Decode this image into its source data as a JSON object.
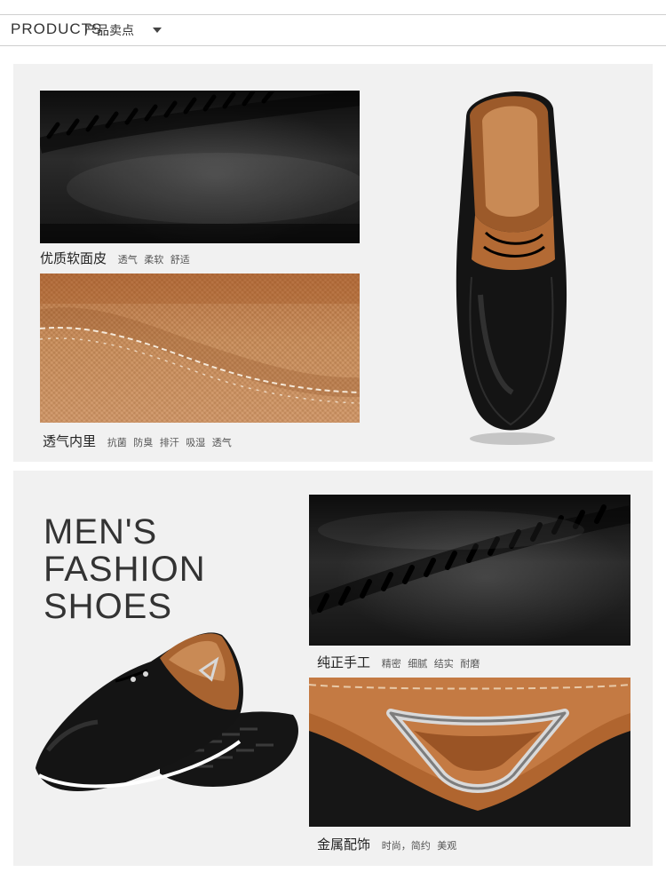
{
  "header": {
    "title_en": "PRODUCTS",
    "title_cn": "产品卖点"
  },
  "features": [
    {
      "title": "优质软面皮",
      "details": "透气 柔软 舒适"
    },
    {
      "title": "透气内里",
      "details": "抗菌 防臭 排汗 吸湿 透气"
    },
    {
      "title": "纯正手工",
      "details": "精密 细腻 结实 耐磨"
    },
    {
      "title": "金属配饰",
      "details": "时尚，简约 美观"
    }
  ],
  "hero": {
    "line1": "MEN'S",
    "line2": "FASHION",
    "line3": "SHOES"
  },
  "colors": {
    "black_leather": "#1a1a1a",
    "tan_leather": "#b8703d",
    "panel_bg": "#f1f1f1"
  },
  "icons": [
    "chevron-down-icon"
  ]
}
